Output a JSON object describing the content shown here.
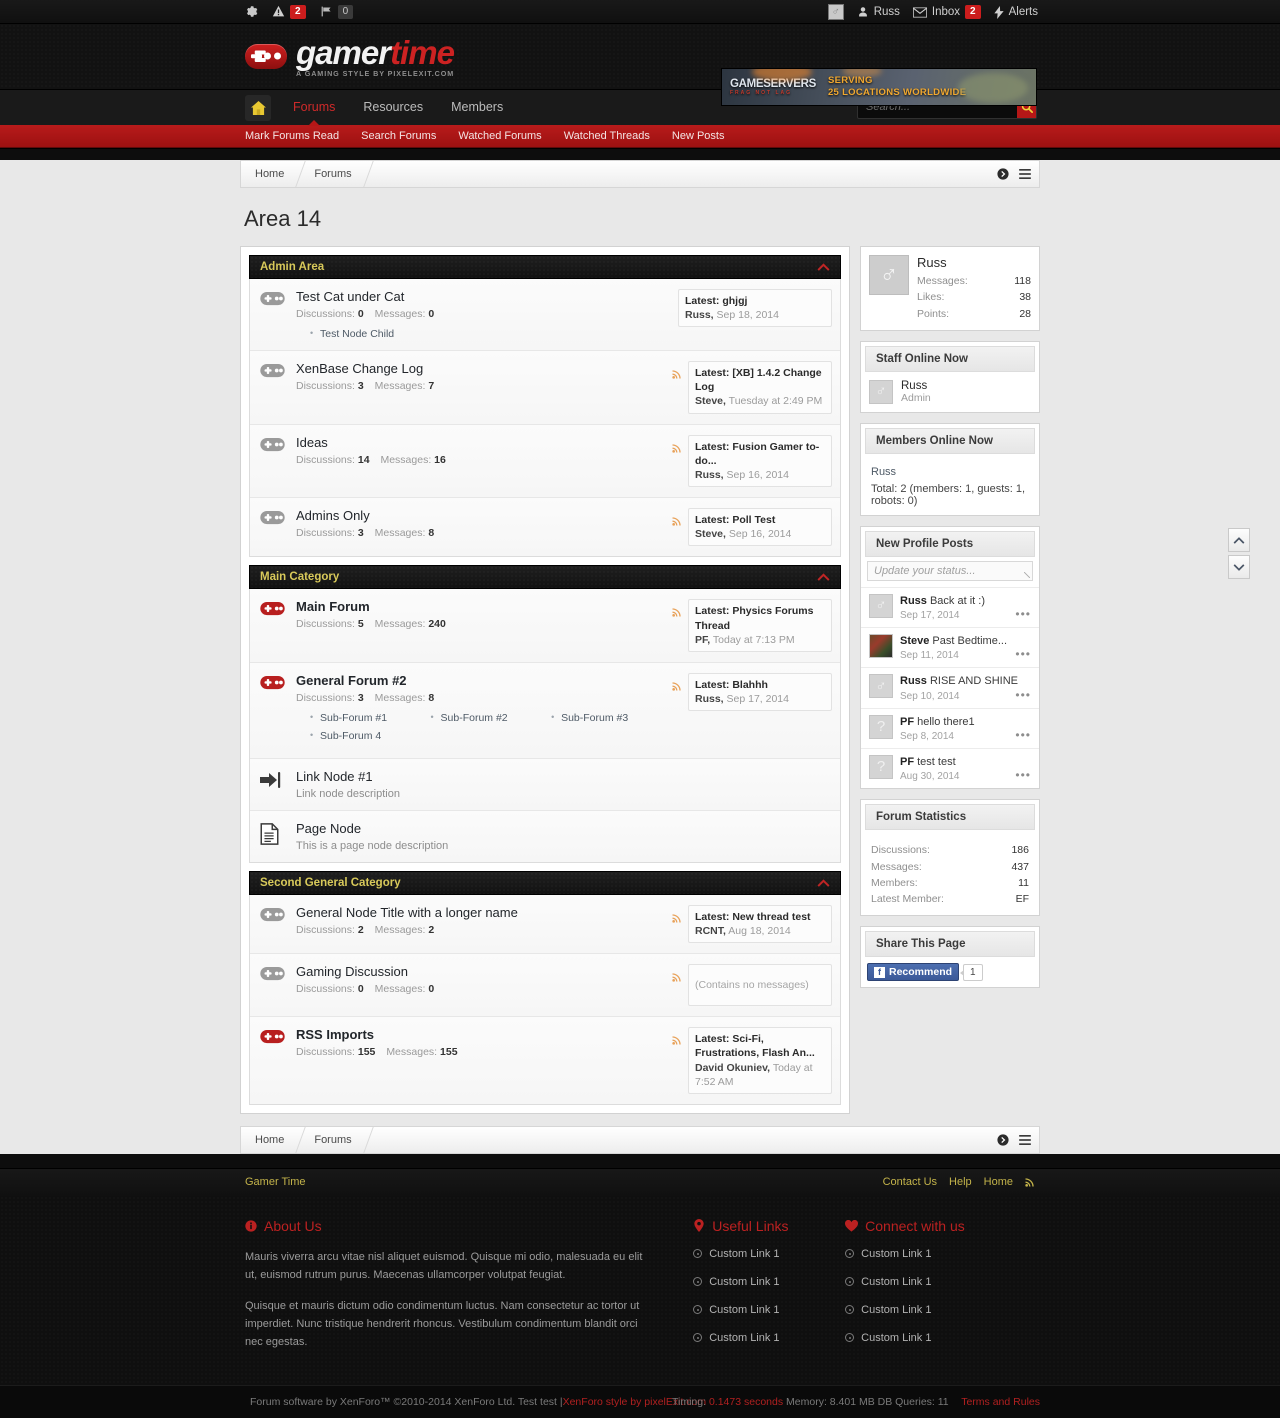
{
  "topbar": {
    "left": [
      {
        "icon": "gear-icon",
        "label": ""
      },
      {
        "icon": "warning-icon",
        "label": "2"
      },
      {
        "icon": "flag-icon",
        "label": "0"
      }
    ],
    "user_name": "Russ",
    "inbox_label": "Inbox",
    "inbox_count": "2",
    "alerts_label": "Alerts"
  },
  "header": {
    "logo_word1": "gamer",
    "logo_word2": "time",
    "logo_tagline": "A GAMING STYLE BY PIXELEXIT.COM",
    "ad": {
      "brand": "GAMESERVERS",
      "brand_sub": "FRAG NOT LAG",
      "line1": "SERVING",
      "line2": "25 LOCATIONS WORLDWIDE"
    }
  },
  "nav": {
    "items": [
      {
        "label": "Forums",
        "active": true
      },
      {
        "label": "Resources",
        "active": false
      },
      {
        "label": "Members",
        "active": false
      }
    ],
    "search_placeholder": "Search...",
    "search_value": ""
  },
  "subnav": [
    "Mark Forums Read",
    "Search Forums",
    "Watched Forums",
    "Watched Threads",
    "New Posts"
  ],
  "breadcrumb": [
    "Home",
    "Forums"
  ],
  "page_title": "Area 14",
  "categories": [
    {
      "title": "Admin Area",
      "nodes": [
        {
          "type": "forum",
          "unread": false,
          "title": "Test Cat under Cat",
          "discussions_label": "Discussions:",
          "discussions": "0",
          "messages_label": "Messages:",
          "messages": "0",
          "rss": false,
          "last": {
            "title": "Latest: ghjgj",
            "user": "Russ,",
            "date": " Sep 18, 2014"
          },
          "children": [
            "Test Node Child"
          ]
        },
        {
          "type": "forum",
          "unread": false,
          "title": "XenBase Change Log",
          "discussions_label": "Discussions:",
          "discussions": "3",
          "messages_label": "Messages:",
          "messages": "7",
          "rss": true,
          "last": {
            "title": "Latest: [XB] 1.4.2 Change Log",
            "user": "Steve,",
            "date": " Tuesday at 2:49 PM"
          }
        },
        {
          "type": "forum",
          "unread": false,
          "title": "Ideas",
          "discussions_label": "Discussions:",
          "discussions": "14",
          "messages_label": "Messages:",
          "messages": "16",
          "rss": true,
          "last": {
            "title": "Latest: Fusion Gamer to-do...",
            "user": "Russ,",
            "date": " Sep 16, 2014"
          }
        },
        {
          "type": "forum",
          "unread": false,
          "title": "Admins Only",
          "discussions_label": "Discussions:",
          "discussions": "3",
          "messages_label": "Messages:",
          "messages": "8",
          "rss": true,
          "last": {
            "title": "Latest: Poll Test",
            "user": "Steve,",
            "date": " Sep 16, 2014"
          }
        }
      ]
    },
    {
      "title": "Main Category",
      "nodes": [
        {
          "type": "forum",
          "unread": true,
          "title": "Main Forum",
          "discussions_label": "Discussions:",
          "discussions": "5",
          "messages_label": "Messages:",
          "messages": "240",
          "rss": true,
          "last": {
            "title": "Latest: Physics Forums Thread",
            "user": "PF,",
            "date": " Today at 7:13 PM"
          }
        },
        {
          "type": "forum",
          "unread": true,
          "title": "General Forum #2",
          "discussions_label": "Discussions:",
          "discussions": "3",
          "messages_label": "Messages:",
          "messages": "8",
          "rss": true,
          "last": {
            "title": "Latest: Blahhh",
            "user": "Russ,",
            "date": " Sep 17, 2014"
          },
          "subforums": [
            "Sub-Forum #1",
            "Sub-Forum #2",
            "Sub-Forum #3",
            "Sub-Forum 4"
          ]
        },
        {
          "type": "link",
          "title": "Link Node #1",
          "description": "Link node description"
        },
        {
          "type": "page",
          "title": "Page Node",
          "description": "This is a page node description"
        }
      ]
    },
    {
      "title": "Second General Category",
      "nodes": [
        {
          "type": "forum",
          "unread": false,
          "title": "General Node Title with a longer name",
          "discussions_label": "Discussions:",
          "discussions": "2",
          "messages_label": "Messages:",
          "messages": "2",
          "rss": true,
          "last": {
            "title": "Latest: New thread test",
            "user": "RCNT,",
            "date": " Aug 18, 2014"
          }
        },
        {
          "type": "forum",
          "unread": false,
          "title": "Gaming Discussion",
          "discussions_label": "Discussions:",
          "discussions": "0",
          "messages_label": "Messages:",
          "messages": "0",
          "rss": true,
          "last_empty": "(Contains no messages)"
        },
        {
          "type": "forum",
          "unread": true,
          "title": "RSS Imports",
          "discussions_label": "Discussions:",
          "discussions": "155",
          "messages_label": "Messages:",
          "messages": "155",
          "rss": true,
          "last": {
            "title": "Latest: Sci-Fi, Frustrations, Flash An...",
            "user": "David Okuniev,",
            "date": " Today at 7:52 AM"
          }
        }
      ]
    }
  ],
  "sidebar": {
    "visitor": {
      "name": "Russ",
      "stats": [
        {
          "label": "Messages:",
          "value": "118"
        },
        {
          "label": "Likes:",
          "value": "38"
        },
        {
          "label": "Points:",
          "value": "28"
        }
      ]
    },
    "staff_online": {
      "title": "Staff Online Now",
      "members": [
        {
          "name": "Russ",
          "title": "Admin"
        }
      ]
    },
    "members_online": {
      "title": "Members Online Now",
      "names": "Russ",
      "total": "Total: 2 (members: 1, guests: 1, robots: 0)"
    },
    "profile_posts": {
      "title": "New Profile Posts",
      "status_placeholder": "Update your status...",
      "posts": [
        {
          "user": "Russ",
          "text": "Back at it :)",
          "date": "Sep 17, 2014",
          "avatar": "male",
          "more": "•••"
        },
        {
          "user": "Steve",
          "text": "Past Bedtime...",
          "date": "Sep 11, 2014",
          "avatar": "photo",
          "more": "•••"
        },
        {
          "user": "Russ",
          "text": "RISE AND SHINE",
          "date": "Sep 10, 2014",
          "avatar": "male",
          "more": "•••"
        },
        {
          "user": "PF",
          "text": "hello there1",
          "date": "Sep 8, 2014",
          "avatar": "unknown",
          "more": "•••"
        },
        {
          "user": "PF",
          "text": "test test",
          "date": "Aug 30, 2014",
          "avatar": "unknown",
          "more": "•••"
        }
      ]
    },
    "forum_statistics": {
      "title": "Forum Statistics",
      "rows": [
        {
          "label": "Discussions:",
          "value": "186"
        },
        {
          "label": "Messages:",
          "value": "437"
        },
        {
          "label": "Members:",
          "value": "11"
        },
        {
          "label": "Latest Member:",
          "value": "EF"
        }
      ]
    },
    "share": {
      "title": "Share This Page",
      "fb_label": "Recommend",
      "fb_count": "1"
    }
  },
  "footer": {
    "site_name": "Gamer Time",
    "top_links": [
      "Contact Us",
      "Help",
      "Home"
    ],
    "about": {
      "heading": "About Us",
      "p1": "Mauris viverra arcu vitae nisl aliquet euismod. Quisque mi odio, malesuada eu elit ut, euismod rutrum purus. Maecenas ullamcorper volutpat feugiat.",
      "p2": "Quisque et mauris dictum odio condimentum luctus. Nam consectetur ac tortor ut imperdiet. Nunc tristique hendrerit rhoncus. Vestibulum condimentum blandit orci nec egestas."
    },
    "useful": {
      "heading": "Useful Links",
      "links": [
        "Custom Link 1",
        "Custom Link 1",
        "Custom Link 1",
        "Custom Link 1"
      ]
    },
    "connect": {
      "heading": "Connect with us",
      "links": [
        "Custom Link 1",
        "Custom Link 1",
        "Custom Link 1",
        "Custom Link 1"
      ]
    },
    "copyright": "Forum software by XenForo™ ©2010-2014 XenForo Ltd. Test test | ",
    "copyright_style": "XenForo style by pixelExit.com",
    "timing_label": "Timing: ",
    "timing_value": "0.1473 seconds",
    "memory": " Memory: 8.401 MB DB Queries: 11",
    "terms": "Terms and Rules"
  },
  "colors": {
    "accent_red": "#b51717",
    "category_yellow": "#d8c95a",
    "footer_heading": "#bb2121"
  }
}
